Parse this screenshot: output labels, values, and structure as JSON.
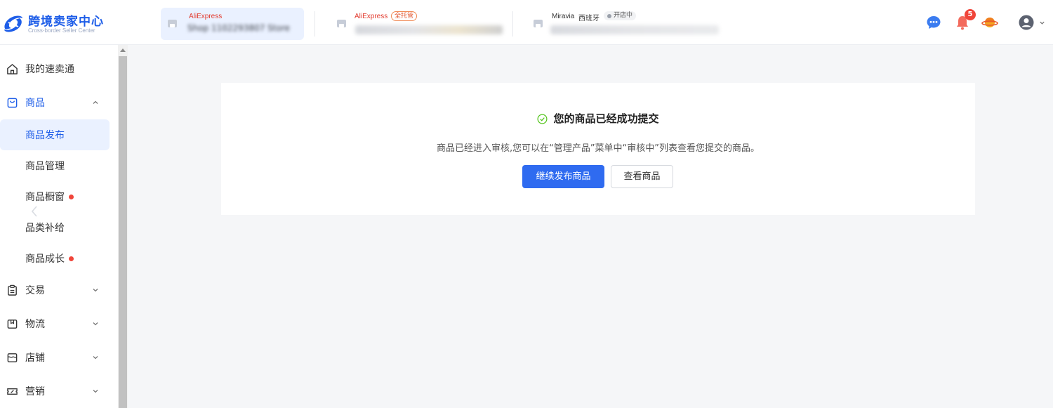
{
  "header": {
    "logo_title": "跨境卖家中心",
    "logo_subtitle": "Cross-border Seller Center",
    "stores": [
      {
        "brand": "AliExpress",
        "tag": "",
        "country": "",
        "status": "",
        "name": "Shop 1102293807 Store"
      },
      {
        "brand": "AliExpress",
        "tag": "全托管",
        "country": "",
        "status": "",
        "name": ""
      },
      {
        "brand": "Miravia",
        "tag": "",
        "country": "西班牙",
        "status": "开店中",
        "name": ""
      }
    ],
    "notification_count": "5",
    "colors": {
      "brand_blue": "#1d5de8",
      "aliexpress_red": "#e23a2e",
      "badge_red": "#f0453a"
    }
  },
  "sidebar": {
    "items": [
      {
        "label": "我的速卖通",
        "icon": "home-icon"
      },
      {
        "label": "商品",
        "icon": "shopping-bag-icon",
        "expanded": true,
        "children": [
          {
            "label": "商品发布",
            "active": true,
            "dot": false
          },
          {
            "label": "商品管理",
            "active": false,
            "dot": false
          },
          {
            "label": "商品橱窗",
            "active": false,
            "dot": true
          },
          {
            "label": "品类补给",
            "active": false,
            "dot": false
          },
          {
            "label": "商品成长",
            "active": false,
            "dot": true
          }
        ]
      },
      {
        "label": "交易",
        "icon": "clipboard-icon"
      },
      {
        "label": "物流",
        "icon": "box-icon"
      },
      {
        "label": "店铺",
        "icon": "store-icon"
      },
      {
        "label": "营销",
        "icon": "ticket-icon"
      }
    ]
  },
  "result": {
    "title": "您的商品已经成功提交",
    "description": "商品已经进入审核,您可以在“管理产品”菜单中“审核中”列表查看您提交的商品。",
    "primary_button": "继续发布商品",
    "secondary_button": "查看商品",
    "success_color": "#52c41a",
    "primary_color": "#2f6bf0"
  }
}
